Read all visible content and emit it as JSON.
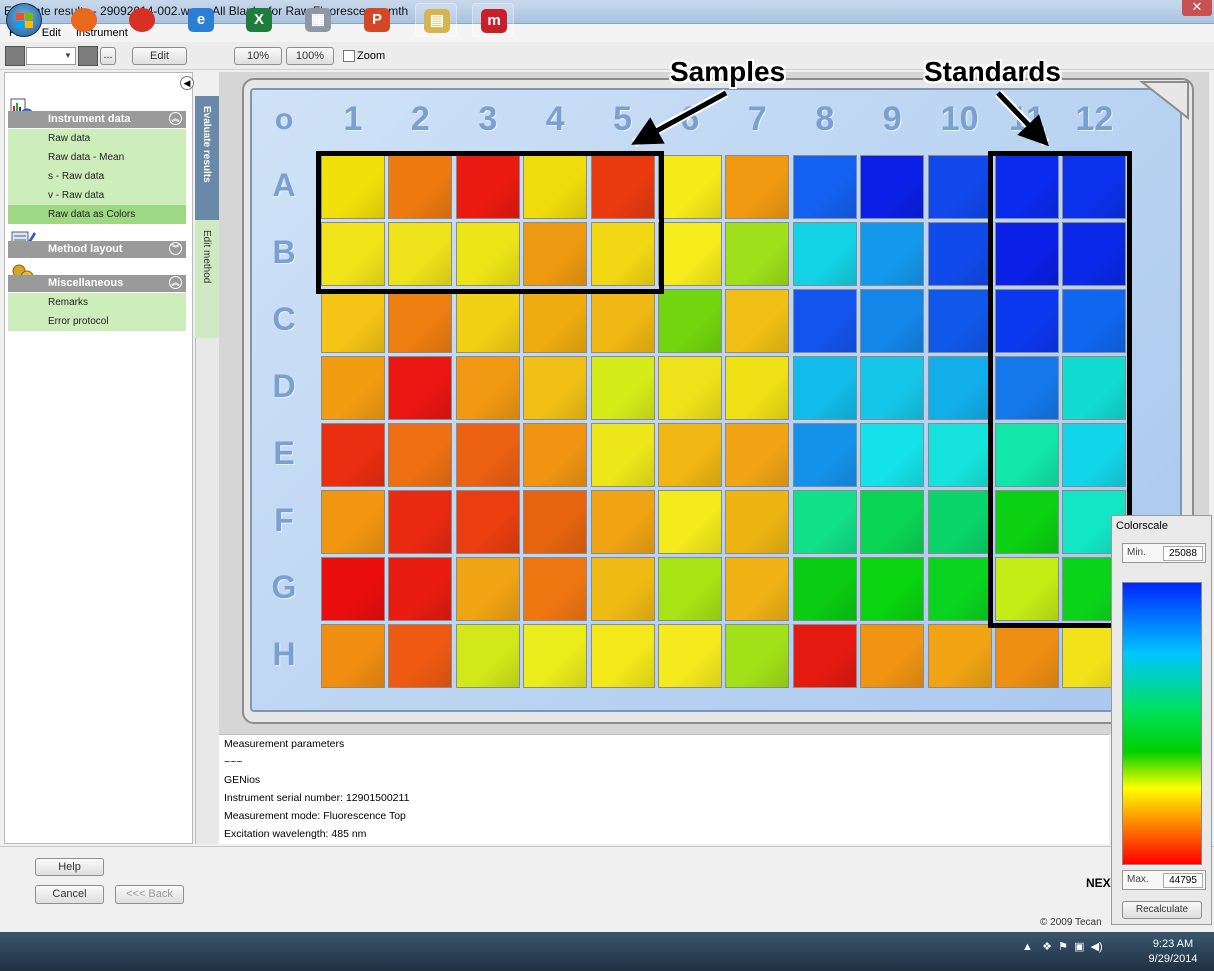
{
  "window": {
    "title": "Evaluate results - 29092014-002.wsp - All Blanks for Raw Fluorescence.mth",
    "close_glyph": "✕"
  },
  "menu": [
    "File",
    "Edit",
    "Instrument"
  ],
  "toolbar": {
    "edit_label": "Edit",
    "dots_label": "...",
    "zoom10": "10%",
    "zoom100": "100%",
    "zoom_label": "Zoom"
  },
  "sidebar": {
    "groups": [
      {
        "title": "Instrument data",
        "expanded": true,
        "items": [
          "Raw data",
          "Raw data - Mean",
          "s - Raw data",
          "v - Raw data",
          "Raw data as Colors"
        ],
        "selected": 4
      },
      {
        "title": "Method layout",
        "expanded": false,
        "items": []
      },
      {
        "title": "Miscellaneous",
        "expanded": true,
        "items": [
          "Remarks",
          "Error protocol"
        ]
      }
    ]
  },
  "tabs": {
    "evaluate": "Evaluate results",
    "edit": "Edit method"
  },
  "plate": {
    "corner": "o",
    "columns": [
      "1",
      "2",
      "3",
      "4",
      "5",
      "6",
      "7",
      "8",
      "9",
      "10",
      "11",
      "12"
    ],
    "rows": [
      "A",
      "B",
      "C",
      "D",
      "E",
      "F",
      "G",
      "H"
    ],
    "well_colors": [
      [
        "#f2e00a",
        "#ee7a10",
        "#ea1a10",
        "#f0dc0c",
        "#ea3a10",
        "#f6ea1a",
        "#f09a12",
        "#1460f0",
        "#0a20e6",
        "#1048ec",
        "#0a2aee",
        "#0a32ec"
      ],
      [
        "#f2e41a",
        "#eee21a",
        "#ece416",
        "#ee9a10",
        "#f2d814",
        "#f6ec1c",
        "#9ee01a",
        "#14d2e6",
        "#1498ec",
        "#104aea",
        "#0a20e6",
        "#0a28e8"
      ],
      [
        "#f4c416",
        "#ee7e12",
        "#f2d016",
        "#eeac10",
        "#f0b814",
        "#72d60e",
        "#f0c016",
        "#1454ee",
        "#1486ea",
        "#1058ea",
        "#0a38ee",
        "#1066ee"
      ],
      [
        "#f29c12",
        "#ea1612",
        "#f09812",
        "#f0c016",
        "#d6ec1a",
        "#eee21a",
        "#f0e016",
        "#12bcea",
        "#16c6ea",
        "#12aeea",
        "#1478ea",
        "#12dcd2"
      ],
      [
        "#ea2e10",
        "#ee7012",
        "#ec6012",
        "#f09412",
        "#ece61a",
        "#f0b614",
        "#f0a416",
        "#1492ea",
        "#16e2ea",
        "#16e4dc",
        "#12e6a8",
        "#14d6ea"
      ],
      [
        "#f29612",
        "#ea2a10",
        "#ea3e10",
        "#e66410",
        "#f0a414",
        "#f4ea1c",
        "#eeb412",
        "#12e08a",
        "#0ad454",
        "#0ad46a",
        "#0cd012",
        "#12e6c4"
      ],
      [
        "#ea0e0e",
        "#e81c10",
        "#f0a414",
        "#f07612",
        "#f0ba14",
        "#a8e414",
        "#f0b214",
        "#0acc12",
        "#0ad410",
        "#0ad420",
        "#c4ec16",
        "#0ad41a"
      ],
      [
        "#f08e12",
        "#ee5a12",
        "#d2e81a",
        "#eaec1c",
        "#f2e81a",
        "#f4ea1e",
        "#a2e018",
        "#e41a10",
        "#f09412",
        "#f0a414",
        "#ee8e12",
        "#f2e21a"
      ]
    ]
  },
  "annotations": {
    "samples": "Samples",
    "standards": "Standards"
  },
  "info": {
    "lines": [
      "Measurement parameters",
      "~~~",
      "GENios",
      "Instrument serial number: 12901500211",
      "Measurement mode: Fluorescence Top",
      "Excitation wavelength: 485 nm"
    ]
  },
  "buttons": {
    "help": "Help",
    "cancel": "Cancel",
    "back": "<<< Back",
    "next": "NEX"
  },
  "copyright": "© 2009 Tecan",
  "colorscale": {
    "title": "Colorscale",
    "min_label": "Min.",
    "min_value": "25088",
    "max_label": "Max.",
    "max_value": "44795",
    "recalc": "Recalculate"
  },
  "taskbar": {
    "apps": [
      {
        "name": "firefox",
        "glyph": "",
        "color": "#e8691d"
      },
      {
        "name": "chrome",
        "glyph": "",
        "color": "#d93025"
      },
      {
        "name": "internet-explorer",
        "glyph": "e",
        "color": "#2a7fd4"
      },
      {
        "name": "excel",
        "glyph": "X",
        "color": "#1e7d3b"
      },
      {
        "name": "calculator",
        "glyph": "▦",
        "color": "#8d98a6"
      },
      {
        "name": "powerpoint",
        "glyph": "P",
        "color": "#d24726"
      },
      {
        "name": "file-explorer",
        "glyph": "▤",
        "color": "#d8b450"
      },
      {
        "name": "magellan",
        "glyph": "m",
        "color": "#c8202a"
      }
    ],
    "time": "9:23 AM",
    "date": "9/29/2014"
  }
}
